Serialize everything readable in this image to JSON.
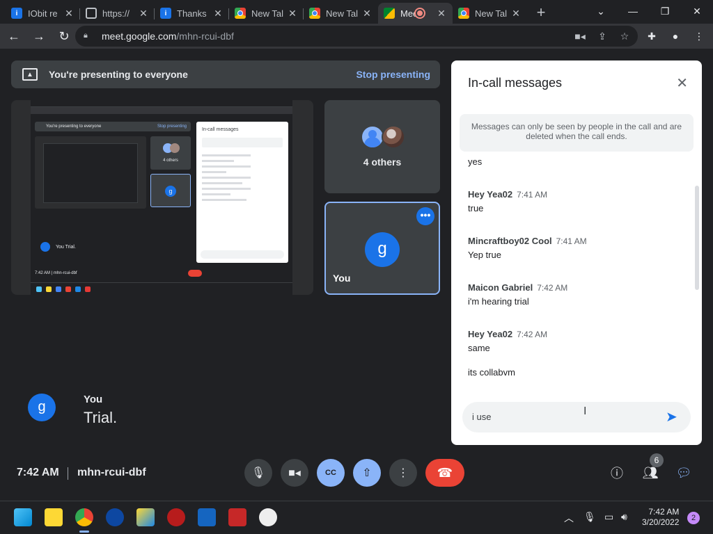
{
  "browser": {
    "tabs": [
      {
        "title": "IObit re",
        "icon": "iobit-icon"
      },
      {
        "title": "https://",
        "icon": "globe-icon"
      },
      {
        "title": "Thanks",
        "icon": "iobit-icon"
      },
      {
        "title": "New Tal",
        "icon": "chrome-icon"
      },
      {
        "title": "New Tal",
        "icon": "chrome-icon"
      },
      {
        "title": "Mee",
        "icon": "meet-icon",
        "active": true,
        "recording": true
      },
      {
        "title": "New Tal",
        "icon": "chrome-icon"
      }
    ],
    "url_host": "meet.google.com",
    "url_path": "/mhn-rcui-dbf"
  },
  "meet": {
    "banner_text": "You're presenting to everyone",
    "stop_presenting": "Stop presenting",
    "others_label": "4 others",
    "you_label": "You",
    "you_initial": "g",
    "caption": {
      "speaker": "You",
      "text": "Trial."
    },
    "time": "7:42 AM",
    "meeting_code": "mhn-rcui-dbf",
    "participants_count": "6"
  },
  "chat": {
    "title": "In-call messages",
    "notice": "Messages can only be seen by people in the call and are deleted when the call ends.",
    "messages": [
      {
        "text": "yes"
      },
      {
        "name": "Hey Yea02",
        "time": "7:41 AM",
        "text": "true"
      },
      {
        "name": "Mincraftboy02 Cool",
        "time": "7:41 AM",
        "text": "Yep true"
      },
      {
        "name": "Maicon Gabriel",
        "time": "7:42 AM",
        "text": "i'm hearing trial"
      },
      {
        "name": "Hey Yea02",
        "time": "7:42 AM",
        "text": "same"
      },
      {
        "text": "its collabvm"
      }
    ],
    "input_value": "i use"
  },
  "mini": {
    "banner": "You're presenting to everyone",
    "stop": "Stop presenting",
    "others": "4 others",
    "you": "You",
    "caption": "Trial.",
    "panel_title": "In-call messages",
    "time_code": "7:42 AM  |  mhn-rcui-dbf"
  },
  "taskbar": {
    "time": "7:42 AM",
    "date": "3/20/2022",
    "notifications": "2"
  },
  "colors": {
    "accent": "#8ab4f8",
    "end_call": "#ea4335",
    "meet_blue": "#1a73e8"
  }
}
